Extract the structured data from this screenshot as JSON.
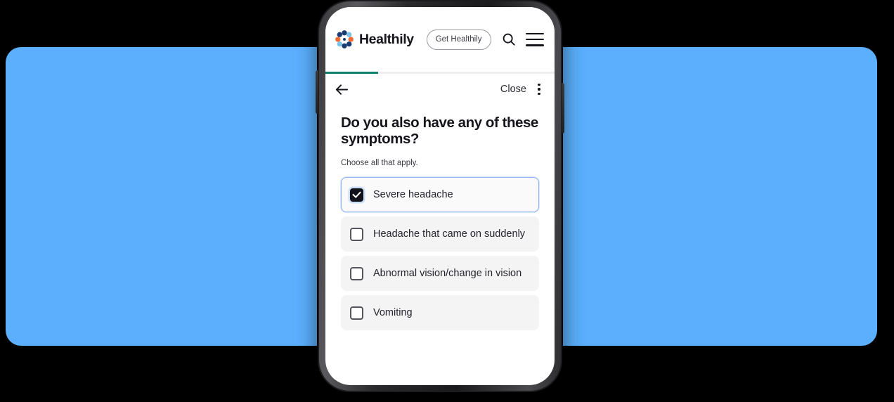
{
  "header": {
    "brand_name": "Healthily",
    "logo_icon": "healthily-flower-logo",
    "cta_label": "Get Healthily",
    "search_icon": "search-icon",
    "menu_icon": "hamburger-menu-icon"
  },
  "progress": {
    "percent": 23
  },
  "nav": {
    "back_icon": "arrow-left-icon",
    "close_label": "Close",
    "overflow_icon": "kebab-menu-icon"
  },
  "question": {
    "title": "Do you also have any of these symptoms?",
    "hint": "Choose all that apply.",
    "options": [
      {
        "label": "Severe headache",
        "checked": true
      },
      {
        "label": "Headache that came on suddenly",
        "checked": false
      },
      {
        "label": "Abnormal vision/change in vision",
        "checked": false
      },
      {
        "label": "Vomiting",
        "checked": false
      }
    ]
  },
  "device": {
    "volume_button": "volume-button",
    "power_button": "power-button"
  },
  "colors": {
    "backdrop_blue": "#5BAFFC",
    "progress_teal": "#0f7f6e",
    "logo_navy": "#1b3c73",
    "logo_orange": "#f26a35",
    "logo_lightblue": "#79c2e8",
    "selected_border": "#8fb4ef",
    "checkbox_dark": "#12121a"
  }
}
